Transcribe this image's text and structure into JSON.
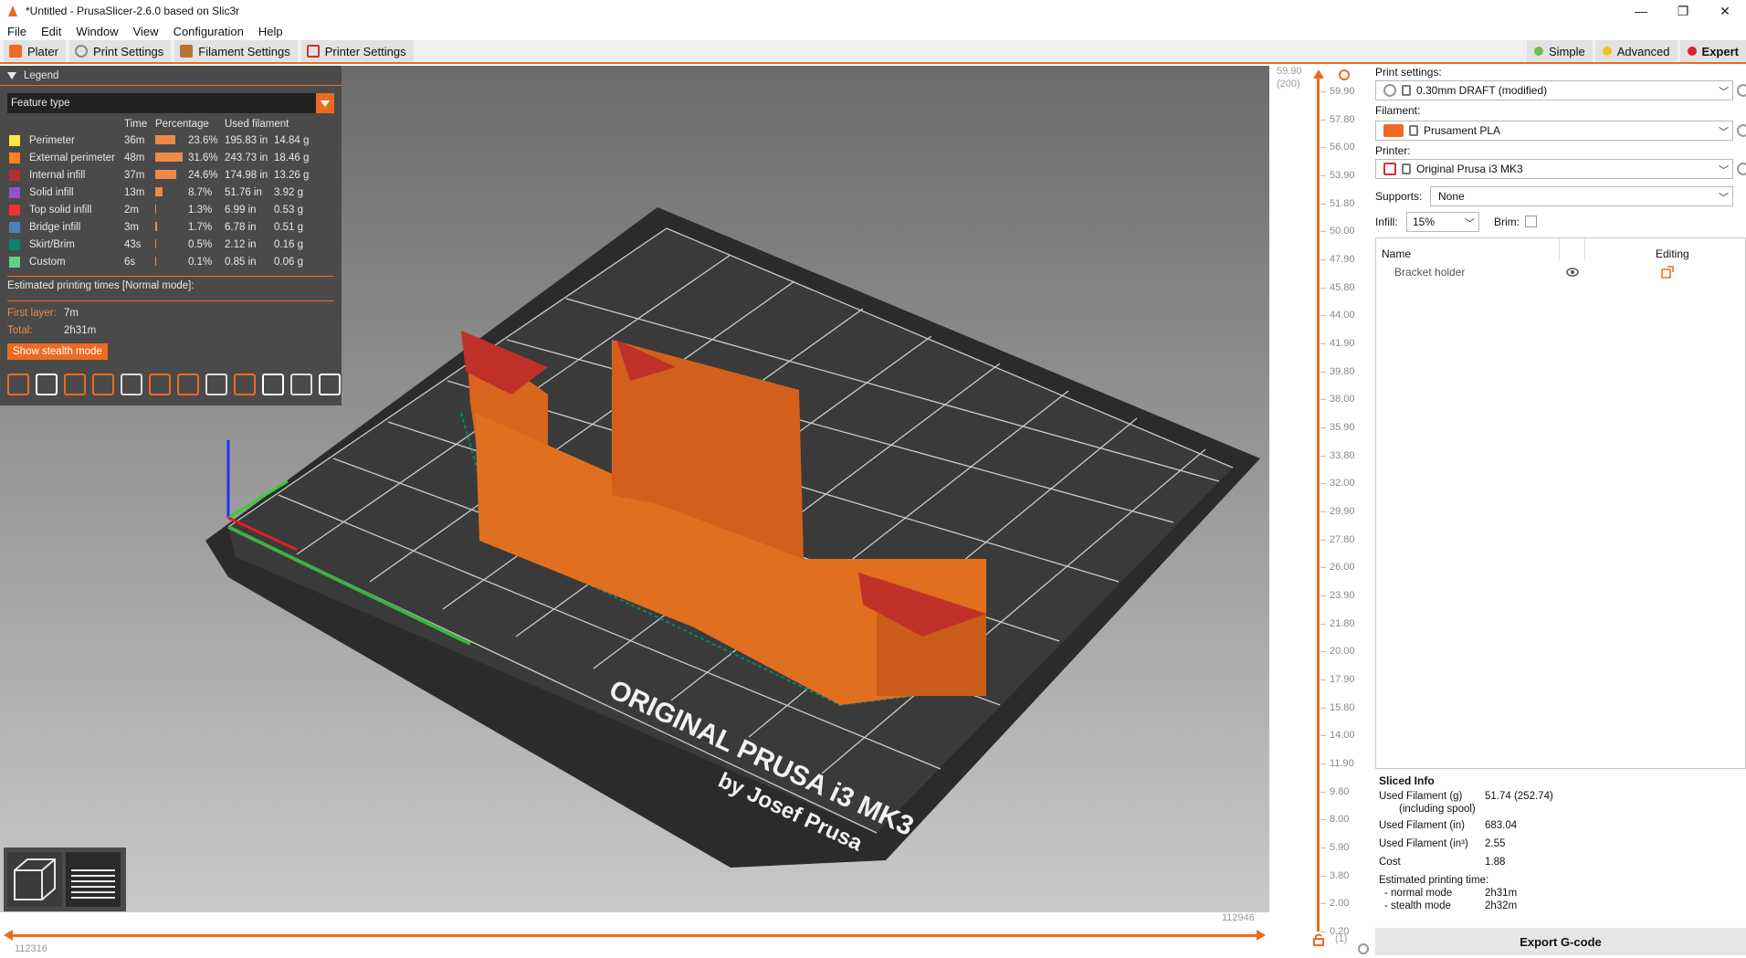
{
  "window": {
    "title": "*Untitled - PrusaSlicer-2.6.0 based on Slic3r",
    "controls": [
      "—",
      "❐",
      "✕"
    ]
  },
  "menu": [
    "File",
    "Edit",
    "Window",
    "View",
    "Configuration",
    "Help"
  ],
  "tabs": [
    {
      "label": "Plater",
      "icon": "plater-icon",
      "color": "#ed6b21"
    },
    {
      "label": "Print Settings",
      "icon": "gear-icon",
      "color": "#888888"
    },
    {
      "label": "Filament Settings",
      "icon": "spool-icon",
      "color": "#b87333"
    },
    {
      "label": "Printer Settings",
      "icon": "printer-icon",
      "color": "#cc3333"
    }
  ],
  "modes": [
    {
      "label": "Simple",
      "color": "#6cc04a"
    },
    {
      "label": "Advanced",
      "color": "#f0c419"
    },
    {
      "label": "Expert",
      "color": "#e02020"
    }
  ],
  "legend": {
    "title": "Legend",
    "view_type": "Feature type",
    "columns": {
      "time": "Time",
      "percentage": "Percentage",
      "used": "Used filament"
    },
    "items": [
      {
        "name": "Perimeter",
        "color": "#ffe640",
        "time": "36m",
        "pct": "23.6%",
        "pct_value": 23.6,
        "length": "195.83 in",
        "weight": "14.84 g"
      },
      {
        "name": "External perimeter",
        "color": "#ff7f27",
        "time": "48m",
        "pct": "31.6%",
        "pct_value": 31.6,
        "length": "243.73 in",
        "weight": "18.46 g"
      },
      {
        "name": "Internal infill",
        "color": "#b03030",
        "time": "37m",
        "pct": "24.6%",
        "pct_value": 24.6,
        "length": "174.98 in",
        "weight": "13.26 g"
      },
      {
        "name": "Solid infill",
        "color": "#9650c8",
        "time": "13m",
        "pct": "8.7%",
        "pct_value": 8.7,
        "length": "51.76 in",
        "weight": "3.92 g"
      },
      {
        "name": "Top solid infill",
        "color": "#f03030",
        "time": "2m",
        "pct": "1.3%",
        "pct_value": 1.3,
        "length": "6.99 in",
        "weight": "0.53 g"
      },
      {
        "name": "Bridge infill",
        "color": "#4d80ba",
        "time": "3m",
        "pct": "1.7%",
        "pct_value": 1.7,
        "length": "6.78 in",
        "weight": "0.51 g"
      },
      {
        "name": "Skirt/Brim",
        "color": "#00876e",
        "time": "43s",
        "pct": "0.5%",
        "pct_value": 0.5,
        "length": "2.12 in",
        "weight": "0.16 g"
      },
      {
        "name": "Custom",
        "color": "#5ed28c",
        "time": "6s",
        "pct": "0.1%",
        "pct_value": 0.1,
        "length": "0.85 in",
        "weight": "0.06 g"
      }
    ],
    "estimated_title": "Estimated printing times [Normal mode]:",
    "first_layer_label": "First layer:",
    "first_layer_value": "7m",
    "total_label": "Total:",
    "total_value": "2h31m",
    "stealth_button": "Show stealth mode",
    "toolbar_icons": [
      "travel-icon",
      "wipe-icon",
      "retractions-icon",
      "deretractions-icon",
      "seams-icon",
      "tool-changes-icon",
      "color-changes-icon",
      "pause-icon",
      "custom-gcode-icon",
      "center-of-gravity-icon",
      "shells-icon",
      "tool-marker-icon"
    ]
  },
  "bed_label": {
    "line1": "ORIGINAL PRUSA i3 MK3",
    "line2": "by Josef Prusa"
  },
  "horizontal_slider": {
    "left_value": "112316",
    "right_value": "112946"
  },
  "vertical_slider": {
    "top_value": "59.90",
    "top_layer": "(200)",
    "bottom_layer": "(1)",
    "ticks": [
      "59.90",
      "57.80",
      "56.00",
      "53.90",
      "51.80",
      "50.00",
      "47.90",
      "45.80",
      "44.00",
      "41.90",
      "39.80",
      "38.00",
      "35.90",
      "33.80",
      "32.00",
      "29.90",
      "27.80",
      "26.00",
      "23.90",
      "21.80",
      "20.00",
      "17.90",
      "15.80",
      "14.00",
      "11.90",
      "9.80",
      "8.00",
      "5.90",
      "3.80",
      "2.00",
      "0.20"
    ]
  },
  "sidebar": {
    "print_settings_label": "Print settings:",
    "print_settings_value": "0.30mm DRAFT (modified)",
    "filament_label": "Filament:",
    "filament_value": "Prusament PLA",
    "filament_color": "#ed6b21",
    "printer_label": "Printer:",
    "printer_value": "Original Prusa i3 MK3",
    "supports_label": "Supports:",
    "supports_value": "None",
    "infill_label": "Infill:",
    "infill_value": "15%",
    "brim_label": "Brim:",
    "object_list": {
      "name_header": "Name",
      "editing_header": "Editing",
      "objects": [
        "Bracket holder"
      ]
    },
    "sliced_info": {
      "title": "Sliced Info",
      "used_g_label": "Used Filament (g)",
      "used_g_sub": "(including spool)",
      "used_g_value": "51.74 (252.74)",
      "used_in_label": "Used Filament (in)",
      "used_in_value": "683.04",
      "used_in3_label": "Used Filament (in³)",
      "used_in3_value": "2.55",
      "cost_label": "Cost",
      "cost_value": "1.88",
      "est_label": "Estimated printing time:",
      "normal_label": "- normal mode",
      "normal_value": "2h31m",
      "stealth_label": "- stealth mode",
      "stealth_value": "2h32m"
    },
    "export_button": "Export G-code"
  }
}
